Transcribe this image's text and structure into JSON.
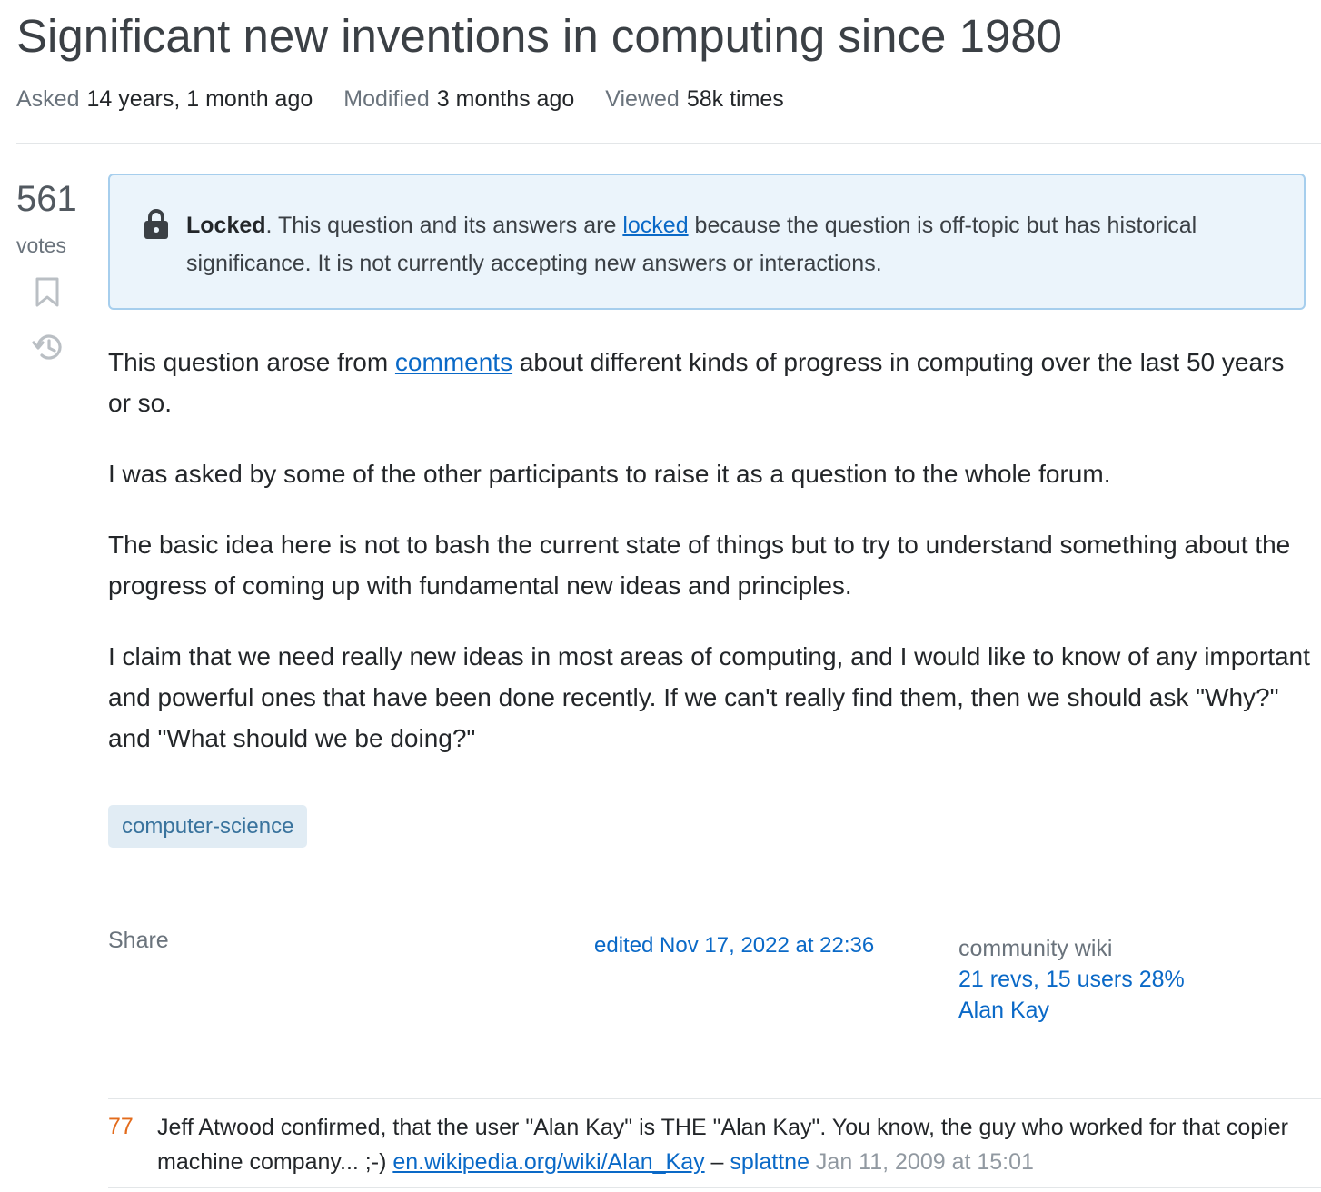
{
  "question": {
    "title": "Significant new inventions in computing since 1980",
    "meta": {
      "asked_label": "Asked",
      "asked_value": "14 years, 1 month ago",
      "modified_label": "Modified",
      "modified_value": "3 months ago",
      "viewed_label": "Viewed",
      "viewed_value": "58k times"
    },
    "votes": {
      "count": "561",
      "label": "votes"
    },
    "notice": {
      "bold": "Locked",
      "text_before_link": ". This question and its answers are ",
      "link": "locked",
      "text_after_link": " because the question is off-topic but has historical significance. It is not currently accepting new answers or interactions."
    },
    "body": {
      "p1_before": "This question arose from ",
      "p1_link": "comments",
      "p1_after": " about different kinds of progress in computing over the last 50 years or so.",
      "p2": "I was asked by some of the other participants to raise it as a question to the whole forum.",
      "p3": "The basic idea here is not to bash the current state of things but to try to understand something about the progress of coming up with fundamental new ideas and principles.",
      "p4": "I claim that we need really new ideas in most areas of computing, and I would like to know of any important and powerful ones that have been done recently. If we can't really find them, then we should ask \"Why?\" and \"What should we be doing?\""
    },
    "tags": [
      "computer-science"
    ],
    "share_label": "Share",
    "edited": "edited Nov 17, 2022 at 22:36",
    "wiki": {
      "label": "community wiki",
      "revs": "21 revs, 15 users 28%",
      "user": "Alan Kay"
    }
  },
  "comment": {
    "score": "77",
    "text_before_link": "Jeff Atwood confirmed, that the user \"Alan Kay\" is THE \"Alan Kay\". You know, the guy who worked for that copier machine company... ;-) ",
    "link": "en.wikipedia.org/wiki/Alan_Kay",
    "dash": " – ",
    "user": "splattne",
    "date": " Jan 11, 2009 at 15:01"
  },
  "colors": {
    "link": "#0a69c7",
    "notice_bg": "#ebf4fb",
    "notice_border": "#a6ceed",
    "tag_bg": "#e1ecf4",
    "tag_text": "#39739d",
    "comment_score": "#e36b1b"
  },
  "icons": [
    "lock-icon",
    "bookmark-icon",
    "history-icon"
  ]
}
